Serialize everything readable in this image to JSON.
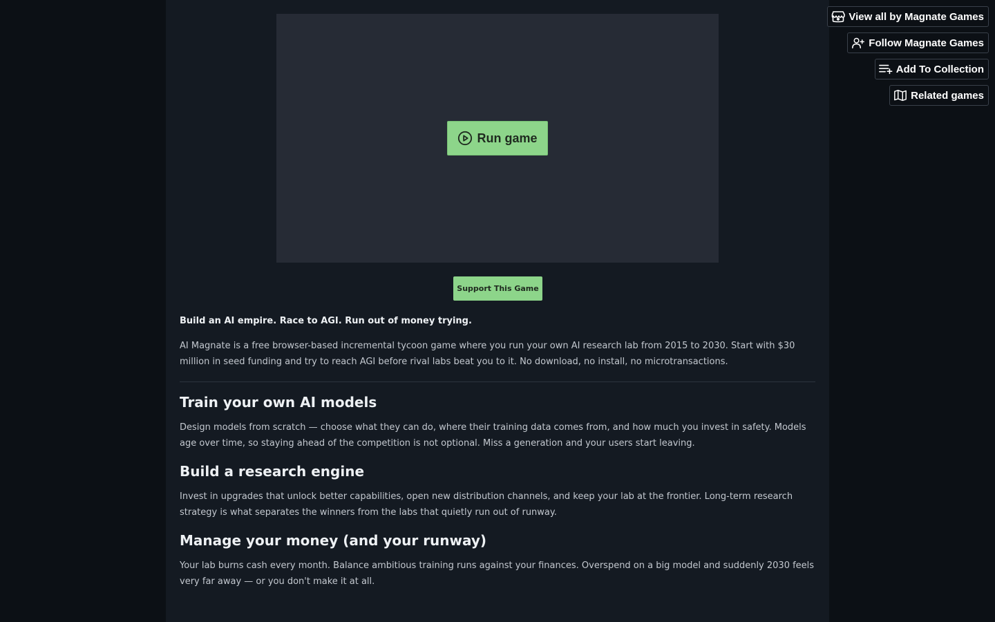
{
  "game": {
    "run_label": "Run game",
    "support_label": "Support This Game"
  },
  "side_actions": {
    "view_all_label": "View all by Magnate Games",
    "follow_label": "Follow Magnate Games",
    "collection_label": "Add To Collection",
    "related_label": "Related games"
  },
  "description": {
    "tagline": "Build an AI empire. Race to AGI. Run out of money trying.",
    "intro": "AI Magnate is a free browser-based incremental tycoon game where you run your own AI research lab from 2015 to 2030. Start with $30 million in seed funding and try to reach AGI before rival labs beat you to it. No download, no install, no microtransactions.",
    "sections": [
      {
        "heading": "Train your own AI models",
        "body": "Design models from scratch — choose what they can do, where their training data comes from, and how much you invest in safety. Models age over time, so staying ahead of the competition is not optional. Miss a generation and your users start leaving."
      },
      {
        "heading": "Build a research engine",
        "body": "Invest in upgrades that unlock better capabilities, open new distribution channels, and keep your lab at the frontier. Long-term research strategy is what separates the winners from the labs that quietly run out of runway."
      },
      {
        "heading": "Manage your money (and your runway)",
        "body": "Your lab burns cash every month. Balance ambitious training runs against your finances. Overspend on a big model and suddenly 2030 feels very far away — or you don't make it at all."
      }
    ]
  },
  "icons": {
    "run": "play-circle-icon",
    "view_all": "itchio-logo-icon",
    "follow": "user-plus-icon",
    "collection": "playlist-add-icon",
    "related": "map-icon"
  },
  "colors": {
    "background": "#0c1015",
    "column": "#141a22",
    "game_frame": "#262b35",
    "accent_green": "#8dd58a"
  }
}
